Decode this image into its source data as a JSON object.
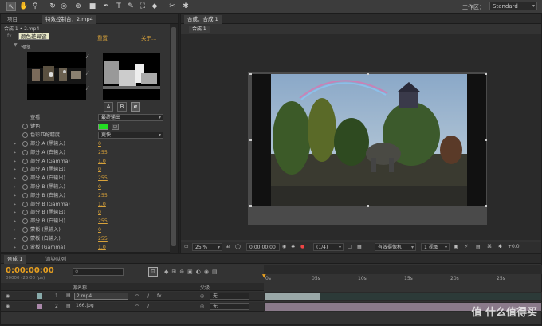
{
  "toolbar": {
    "tools": [
      "selection-tool",
      "hand-tool",
      "zoom-tool",
      "rotate-tool",
      "unified-camera-tool",
      "pan-behind-tool",
      "rectangle-tool",
      "pen-tool",
      "type-tool",
      "brush-tool",
      "clone-stamp-tool",
      "eraser-tool",
      "roto-brush-tool",
      "puppet-tool"
    ],
    "workspace_label": "工作区：",
    "workspace_value": "Standard"
  },
  "effects_panel": {
    "tab_project": "项目",
    "tab_effects": "特效控制台：2.mp4",
    "header_comp": "合成 1 • 2.mp4",
    "tooltip": "颜色差异键",
    "layer_label": "颜色差异键",
    "reset_label": "重置",
    "about_label": "关于...",
    "preview_label": "预览",
    "alpha_buttons": [
      "A",
      "B",
      "α"
    ],
    "view_label": "查看",
    "view_value": "最终输出",
    "key_color_label": "键色",
    "key_color_hex": "#22dd22",
    "color_match_label": "色彩匹配精度",
    "color_match_value": "更快",
    "params": [
      {
        "label": "部分 A (黑输入)",
        "value": "0"
      },
      {
        "label": "部分 A (白输入)",
        "value": "255"
      },
      {
        "label": "部分 A (Gamma)",
        "value": "1.0"
      },
      {
        "label": "部分 A (黑输出)",
        "value": "0"
      },
      {
        "label": "部分 A (白输出)",
        "value": "255"
      },
      {
        "label": "部分 B (黑输入)",
        "value": "0"
      },
      {
        "label": "部分 B (白输入)",
        "value": "255"
      },
      {
        "label": "部分 B (Gamma)",
        "value": "1.0"
      },
      {
        "label": "部分 B (黑输出)",
        "value": "0"
      },
      {
        "label": "部分 B (白输出)",
        "value": "255"
      },
      {
        "label": "蒙板 (黑输入)",
        "value": "0"
      },
      {
        "label": "蒙板 (白输入)",
        "value": "255"
      },
      {
        "label": "蒙板 (Gamma)",
        "value": "1.0"
      }
    ]
  },
  "comp_panel": {
    "tab_label": "合成：合成 1",
    "sub_tab": "合成 1",
    "status": {
      "zoom": "25 %",
      "timecode": "0:00:00:00",
      "resolution": "(1/4)",
      "camera": "有效摄像机",
      "views": "1 视图",
      "exposure": "+0.0"
    }
  },
  "timeline": {
    "tab_comp": "合成 1",
    "tab_render": "渲染队列",
    "timecode": "0:00:00:00",
    "frames": "00000 (25.00 fps)",
    "search_placeholder": "",
    "col_source": "源名称",
    "col_parent": "父级",
    "ruler": [
      "0s",
      "05s",
      "10s",
      "15s",
      "20s",
      "25s"
    ],
    "layers": [
      {
        "num": "1",
        "name": "2.mp4",
        "parent": "无"
      },
      {
        "num": "2",
        "name": "166.jpg",
        "parent": "无"
      }
    ]
  },
  "watermark": "值 什么值得买"
}
